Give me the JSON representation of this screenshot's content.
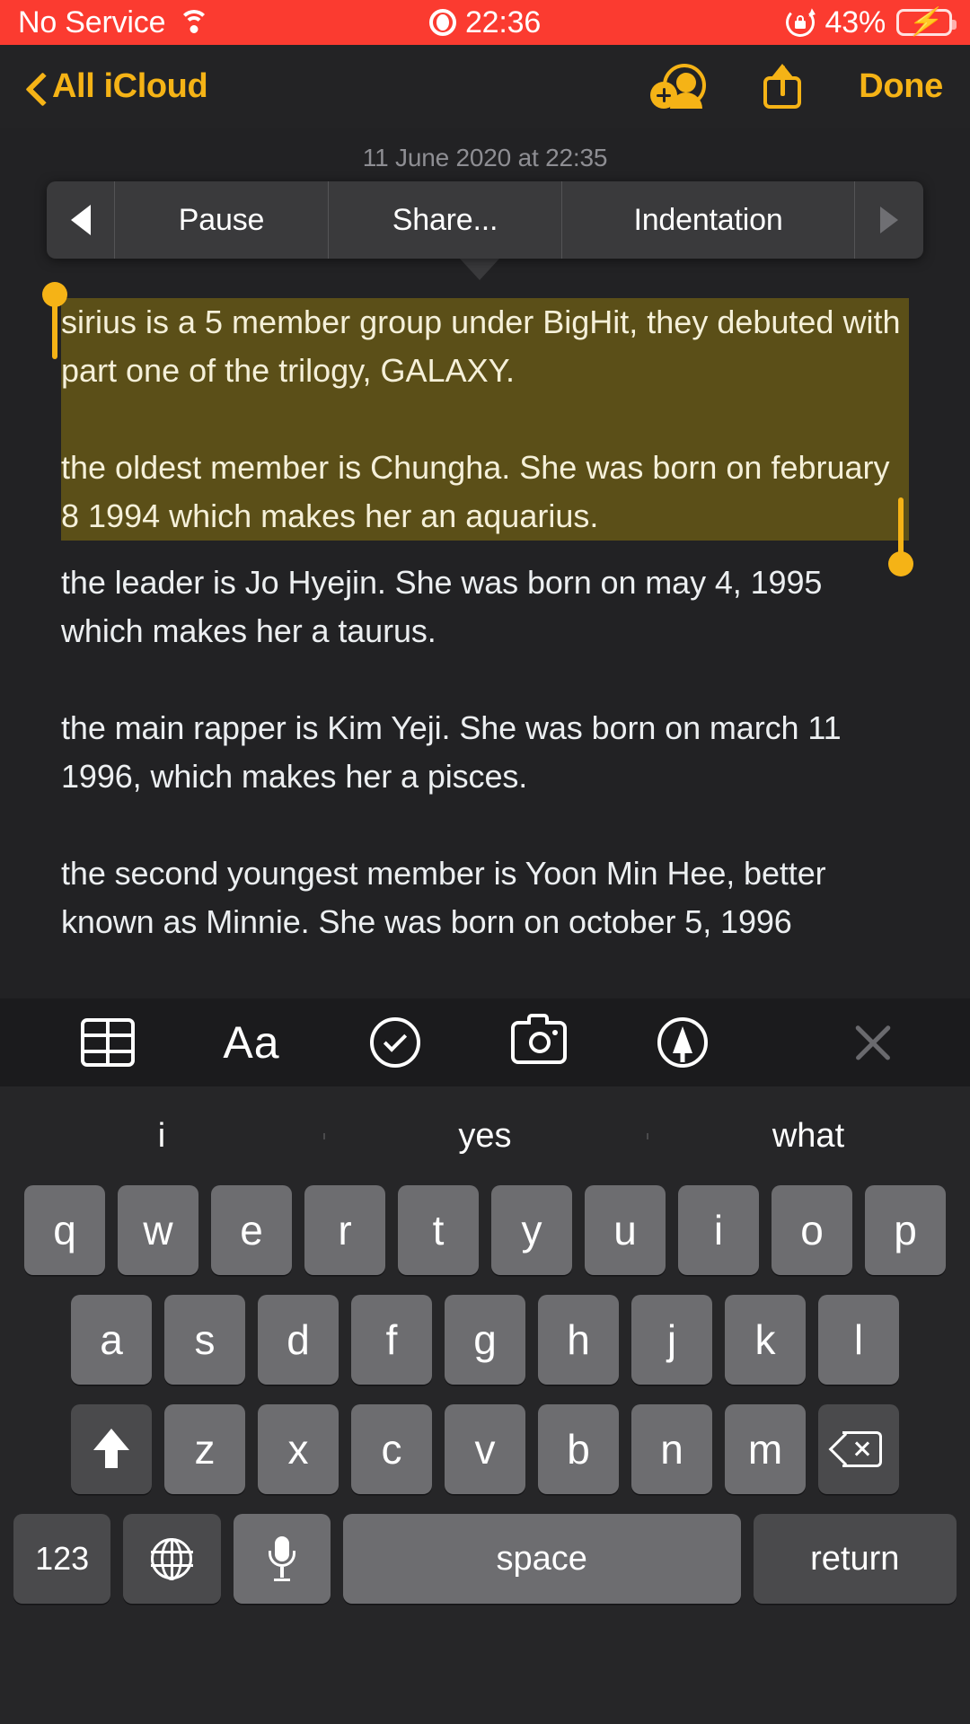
{
  "status_bar": {
    "carrier": "No Service",
    "wifi_icon": "wifi-icon",
    "record_icon": "record-icon",
    "time": "22:36",
    "rotation_lock_icon": "rotation-lock-icon",
    "battery_percent": "43%",
    "battery_icon": "battery-charging-icon",
    "background_color": "#fb3b30",
    "accent_color": "#4cd964"
  },
  "nav_bar": {
    "back_icon": "chevron-left-icon",
    "back_label": "All iCloud",
    "add_person_icon": "add-person-icon",
    "share_icon": "share-icon",
    "done_label": "Done",
    "accent_color": "#f5b316"
  },
  "note": {
    "date": "11 June 2020 at 22:35",
    "selected_paragraphs": [
      "sirius is a 5 member group under BigHit, they debuted with part one of the trilogy, GALAXY.",
      "the oldest member is Chungha. She was born on february 8 1994 which makes her an aquarius."
    ],
    "paragraphs": [
      "the leader is Jo Hyejin. She was born on may 4, 1995 which makes her a taurus.",
      "the main rapper is Kim Yeji. She was born on march 11 1996, which makes her a pisces.",
      "the second youngest member is Yoon Min Hee, better known as Minnie. She was born on october 5, 1996"
    ],
    "selection_color": "#5b4f18",
    "handle_color": "#f5b316"
  },
  "edit_menu": {
    "prev_icon": "triangle-left-icon",
    "next_icon": "triangle-right-icon",
    "items": [
      {
        "label": "Pause"
      },
      {
        "label": "Share..."
      },
      {
        "label": "Indentation"
      }
    ]
  },
  "format_bar": {
    "buttons": [
      {
        "icon": "table-icon",
        "label": ""
      },
      {
        "icon": "text-format-icon",
        "label": "Aa"
      },
      {
        "icon": "checklist-icon",
        "label": ""
      },
      {
        "icon": "camera-icon",
        "label": ""
      },
      {
        "icon": "markup-pen-icon",
        "label": ""
      }
    ],
    "close_icon": "close-icon"
  },
  "keyboard": {
    "predictions": [
      "i",
      "yes",
      "what"
    ],
    "row1": [
      "q",
      "w",
      "e",
      "r",
      "t",
      "y",
      "u",
      "i",
      "o",
      "p"
    ],
    "row2": [
      "a",
      "s",
      "d",
      "f",
      "g",
      "h",
      "j",
      "k",
      "l"
    ],
    "row3": [
      "z",
      "x",
      "c",
      "v",
      "b",
      "n",
      "m"
    ],
    "shift_icon": "shift-icon",
    "delete_icon": "backspace-icon",
    "numbers_label": "123",
    "globe_icon": "globe-icon",
    "mic_icon": "microphone-icon",
    "space_label": "space",
    "return_label": "return"
  }
}
